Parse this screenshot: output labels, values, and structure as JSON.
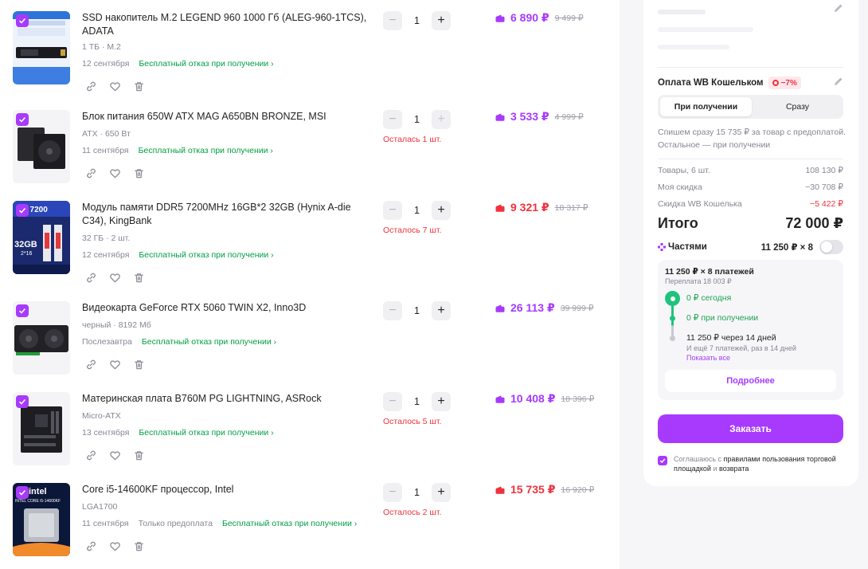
{
  "colors": {
    "accent": "#a73afd",
    "price_discount_red": "#f0323c",
    "green_link": "#00a045",
    "timeline_green": "#1ec47b",
    "muted": "#868695"
  },
  "icons": {
    "check": "check-icon",
    "link": "link-icon",
    "favorite": "heart-icon",
    "delete": "trash-icon",
    "wallet": "wallet-icon",
    "edit": "pencil-icon",
    "parts": "diamond-icon"
  },
  "items": [
    {
      "title": "SSD накопитель M.2 LEGEND 960 1000 Гб (ALEG-960-1TCS), ADATA",
      "specs": "1 ТБ · M.2",
      "date": "12 сентября",
      "prepay": "",
      "refund": "Бесплатный отказ при получении",
      "qty": "1",
      "stock_note": "",
      "price": "6 890 ₽",
      "old_price": "9 499 ₽",
      "price_color": "purple",
      "checked": true
    },
    {
      "title": "Блок питания 650W ATX MAG A650BN BRONZE, MSI",
      "specs": "ATX · 650 Вт",
      "date": "11 сентября",
      "prepay": "",
      "refund": "Бесплатный отказ при получении",
      "qty": "1",
      "stock_note": "Осталась 1 шт.",
      "price": "3 533 ₽",
      "old_price": "4 999 ₽",
      "price_color": "purple",
      "checked": true
    },
    {
      "title": "Модуль памяти DDR5 7200MHz 16GB*2 32GB (Hynix A-die C34), KingBank",
      "specs": "32 ГБ · 2 шт.",
      "date": "12 сентября",
      "prepay": "",
      "refund": "Бесплатный отказ при получении",
      "qty": "1",
      "stock_note": "Осталось 7 шт.",
      "price": "9 321 ₽",
      "old_price": "18 317 ₽",
      "price_color": "red",
      "checked": true
    },
    {
      "title": "Видеокарта GeForce RTX 5060 TWIN X2, Inno3D",
      "specs": "черный · 8192 Мб",
      "date": "Послезавтра",
      "prepay": "",
      "refund": "Бесплатный отказ при получении",
      "qty": "1",
      "stock_note": "",
      "price": "26 113 ₽",
      "old_price": "39 999 ₽",
      "price_color": "purple",
      "checked": true
    },
    {
      "title": "Материнская плата B760M PG LIGHTNING, ASRock",
      "specs": "Micro-ATX",
      "date": "13 сентября",
      "prepay": "",
      "refund": "Бесплатный отказ при получении",
      "qty": "1",
      "stock_note": "Осталось 5 шт.",
      "price": "10 408 ₽",
      "old_price": "18 396 ₽",
      "price_color": "purple",
      "checked": true
    },
    {
      "title": "Core i5-14600KF процессор, Intel",
      "specs": "LGA1700",
      "date": "11 сентября",
      "prepay": "Только предоплата",
      "refund": "Бесплатный отказ при получении",
      "qty": "1",
      "stock_note": "Осталось 2 шт.",
      "price": "15 735 ₽",
      "old_price": "16 920 ₽",
      "price_color": "red",
      "checked": true
    }
  ],
  "thumb_labels": {
    "ram": "R5 7200",
    "ram_capacity": "32GB",
    "ram_timing": "2*16",
    "cpu_brand": "intel",
    "cpu_model": "INTEL CORE i5-14600KF"
  },
  "summary": {
    "payment_title": "Оплата WB Кошельком",
    "payment_discount": "−7%",
    "segment": [
      "При получении",
      "Сразу"
    ],
    "note": "Спишем сразу 15 735 ₽ за товар с предоплатой. Остальное — при получении",
    "rows": [
      {
        "label": "Товары, 6 шт.",
        "value": "108 130 ₽"
      },
      {
        "label": "Моя скидка",
        "value": "−30 708 ₽"
      },
      {
        "label": "Скидка WB Кошелька",
        "value": "−5 422 ₽"
      }
    ],
    "total_label": "Итого",
    "total_value": "72 000 ₽",
    "parts_label": "Частями",
    "parts_value": "11 250 ₽ × 8",
    "plan": {
      "header": "11 250 ₽ × 8 платежей",
      "overpay": "Переплата 18 003 ₽",
      "step1": "0 ₽ сегодня",
      "step2": "0 ₽ при получении",
      "step3": "11 250 ₽ через 14 дней",
      "step3_note": "И ещё 7 платежей, раз в 14 дней",
      "show_all": "Показать все",
      "more": "Подробнее"
    },
    "order_button": "Заказать",
    "agree_prefix": "Соглашаюсь с",
    "agree_link": "правилами пользования торговой площадкой",
    "agree_mid": "и",
    "agree_link2": "возврата"
  }
}
